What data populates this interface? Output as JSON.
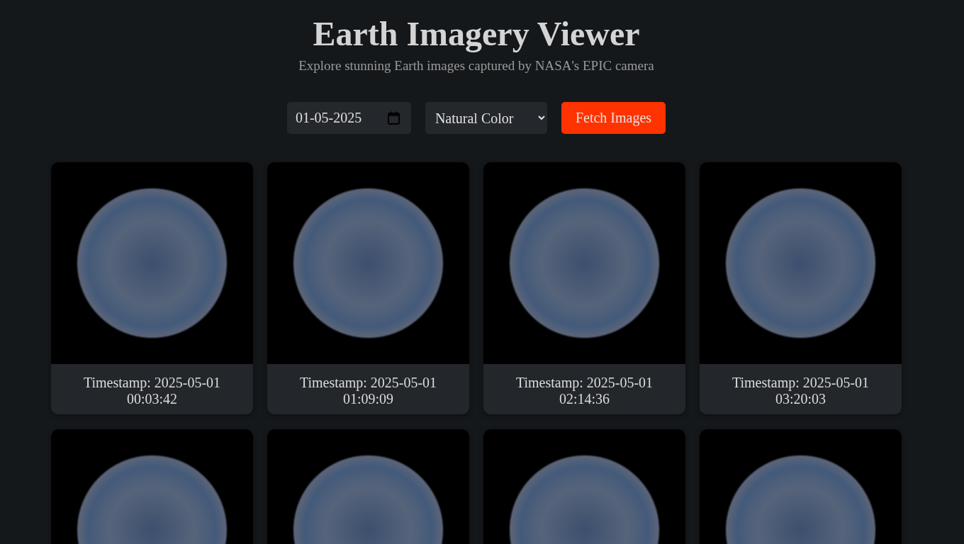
{
  "header": {
    "title": "Earth Imagery Viewer",
    "subtitle": "Explore stunning Earth images captured by NASA's EPIC camera"
  },
  "controls": {
    "date": "01-05-2025",
    "image_type": "Natural Color",
    "button": "Fetch Images"
  },
  "images": [
    {
      "kind": "captioned",
      "timestamp": "Timestamp: 2025-05-01 00:03:42"
    },
    {
      "kind": "captioned",
      "timestamp": "Timestamp: 2025-05-01 01:09:09"
    },
    {
      "kind": "captioned",
      "timestamp": "Timestamp: 2025-05-01 02:14:36"
    },
    {
      "kind": "captioned",
      "timestamp": "Timestamp: 2025-05-01 03:20:03"
    },
    {
      "kind": "photo_only"
    },
    {
      "kind": "photo_only"
    },
    {
      "kind": "photo_only"
    },
    {
      "kind": "photo_only"
    }
  ]
}
